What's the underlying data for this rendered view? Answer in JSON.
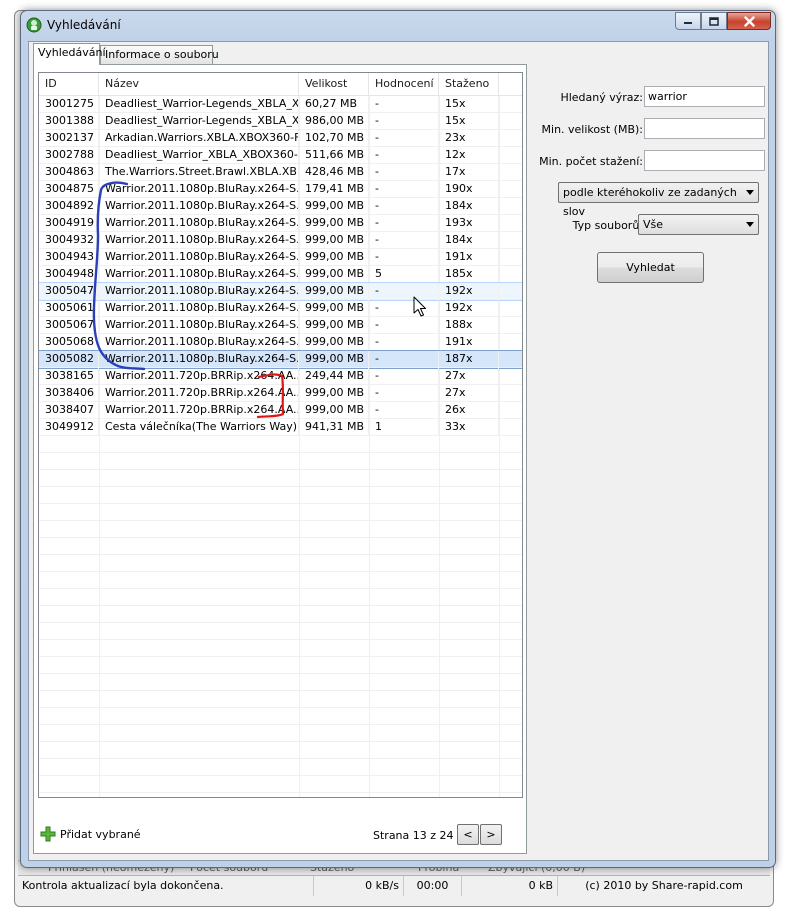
{
  "window": {
    "title": "Vyhledávání"
  },
  "tabs": [
    {
      "label": "Vyhledávání",
      "active": true
    },
    {
      "label": "Informace o souboru",
      "active": false
    }
  ],
  "table": {
    "columns": [
      "ID",
      "Název",
      "Velikost",
      "Hodnocení",
      "Staženo"
    ],
    "rows": [
      {
        "id": "3001275",
        "name": "Deadliest_Warrior-Legends_XBLA_X...",
        "size": "60,27 MB",
        "rating": "-",
        "downloads": "15x"
      },
      {
        "id": "3001388",
        "name": "Deadliest_Warrior-Legends_XBLA_X...",
        "size": "986,00 MB",
        "rating": "-",
        "downloads": "15x"
      },
      {
        "id": "3002137",
        "name": "Arkadian.Warriors.XBLA.XBOX360-F...",
        "size": "102,70 MB",
        "rating": "-",
        "downloads": "23x"
      },
      {
        "id": "3002788",
        "name": "Deadliest_Warrior_XBLA_XBOX360-...",
        "size": "511,66 MB",
        "rating": "-",
        "downloads": "12x"
      },
      {
        "id": "3004863",
        "name": "The.Warriors.Street.Brawl.XBLA.XB...",
        "size": "428,46 MB",
        "rating": "-",
        "downloads": "17x"
      },
      {
        "id": "3004875",
        "name": "Warrior.2011.1080p.BluRay.x264-S...",
        "size": "179,41 MB",
        "rating": "-",
        "downloads": "190x"
      },
      {
        "id": "3004892",
        "name": "Warrior.2011.1080p.BluRay.x264-S...",
        "size": "999,00 MB",
        "rating": "-",
        "downloads": "184x"
      },
      {
        "id": "3004919",
        "name": "Warrior.2011.1080p.BluRay.x264-S...",
        "size": "999,00 MB",
        "rating": "-",
        "downloads": "193x"
      },
      {
        "id": "3004932",
        "name": "Warrior.2011.1080p.BluRay.x264-S...",
        "size": "999,00 MB",
        "rating": "-",
        "downloads": "184x"
      },
      {
        "id": "3004943",
        "name": "Warrior.2011.1080p.BluRay.x264-S...",
        "size": "999,00 MB",
        "rating": "-",
        "downloads": "191x"
      },
      {
        "id": "3004948",
        "name": "Warrior.2011.1080p.BluRay.x264-S...",
        "size": "999,00 MB",
        "rating": "5",
        "downloads": "185x"
      },
      {
        "id": "3005047",
        "name": "Warrior.2011.1080p.BluRay.x264-S...",
        "size": "999,00 MB",
        "rating": "-",
        "downloads": "192x",
        "state": "hover"
      },
      {
        "id": "3005061",
        "name": "Warrior.2011.1080p.BluRay.x264-S...",
        "size": "999,00 MB",
        "rating": "-",
        "downloads": "192x"
      },
      {
        "id": "3005067",
        "name": "Warrior.2011.1080p.BluRay.x264-S...",
        "size": "999,00 MB",
        "rating": "-",
        "downloads": "188x"
      },
      {
        "id": "3005068",
        "name": "Warrior.2011.1080p.BluRay.x264-S...",
        "size": "999,00 MB",
        "rating": "-",
        "downloads": "191x"
      },
      {
        "id": "3005082",
        "name": "Warrior.2011.1080p.BluRay.x264-S...",
        "size": "999,00 MB",
        "rating": "-",
        "downloads": "187x",
        "state": "selected"
      },
      {
        "id": "3038165",
        "name": "Warrior.2011.720p.BRRip.x264.AA...",
        "size": "249,44 MB",
        "rating": "-",
        "downloads": "27x"
      },
      {
        "id": "3038406",
        "name": "Warrior.2011.720p.BRRip.x264.AA...",
        "size": "999,00 MB",
        "rating": "-",
        "downloads": "27x"
      },
      {
        "id": "3038407",
        "name": "Warrior.2011.720p.BRRip.x264.AA...",
        "size": "999,00 MB",
        "rating": "-",
        "downloads": "26x"
      },
      {
        "id": "3049912",
        "name": "Cesta válečníka(The Warriors Way) ...",
        "size": "941,31 MB",
        "rating": "1",
        "downloads": "33x"
      }
    ]
  },
  "bottom": {
    "add_selected": "Přidat vybrané",
    "page_info": "Strana 13 z 24",
    "prev": "<",
    "next": ">"
  },
  "search": {
    "term_label": "Hledaný výraz:",
    "term_value": "warrior",
    "min_size_label": "Min. velikost (MB):",
    "min_size_value": "",
    "min_downloads_label": "Min. počet stažení:",
    "min_downloads_value": "",
    "match_mode": "podle kteréhokoliv ze zadaných slov",
    "file_type_label": "Typ souborů:",
    "file_type_value": "Vše",
    "search_button": "Vyhledat"
  },
  "background_window": {
    "strip_texts": [
      "Přihlášen (neomezeny)",
      "Počet souborů",
      "Staženo",
      "Probíhá",
      "Zbývající (0,00 B)"
    ]
  },
  "statusbar": {
    "message": "Kontrola aktualizací byla dokončena.",
    "speed": "0 kB/s",
    "time": "00:00",
    "size": "0 kB",
    "copyright": "(c) 2010 by Share-rapid.com"
  },
  "colors": {
    "titlebar": "#c0d2e9",
    "close_button": "#c7432f",
    "selected_row": "#d5e6fb",
    "annotation_blue": "#2b3fb8",
    "annotation_red": "#e01515"
  }
}
